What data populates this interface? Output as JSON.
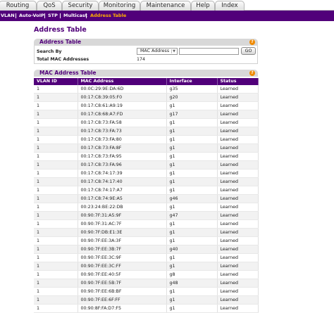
{
  "nav": {
    "tabs": [
      "Routing",
      "QoS",
      "Security",
      "Monitoring",
      "Maintenance",
      "Help",
      "Index"
    ]
  },
  "subnav": {
    "items": [
      "VLAN",
      "Auto-VoIP",
      "STP",
      "Multicast",
      "Address Table"
    ],
    "active": "Address Table"
  },
  "page": {
    "title": "Address Table"
  },
  "address_section": {
    "title": "Address Table",
    "search_by_label": "Search By",
    "search_by_value": "MAC Address",
    "search_input_value": "",
    "go_label": "GO",
    "total_label": "Total MAC Addresses",
    "total_value": "174"
  },
  "mac_section": {
    "title": "MAC Address Table"
  },
  "help_glyph": "?",
  "table": {
    "columns": [
      "VLAN ID",
      "MAC Address",
      "Interface",
      "Status"
    ],
    "rows": [
      [
        "1",
        "00:0C:29:9E:DA:6D",
        "g35",
        "Learned"
      ],
      [
        "1",
        "00:17:C8:39:05:F0",
        "g20",
        "Learned"
      ],
      [
        "1",
        "00:17:C8:61:A9:19",
        "g1",
        "Learned"
      ],
      [
        "1",
        "00:17:C8:68:A7:FD",
        "g17",
        "Learned"
      ],
      [
        "1",
        "00:17:C8:73:FA:58",
        "g1",
        "Learned"
      ],
      [
        "1",
        "00:17:C8:73:FA:73",
        "g1",
        "Learned"
      ],
      [
        "1",
        "00:17:C8:73:FA:80",
        "g1",
        "Learned"
      ],
      [
        "1",
        "00:17:C8:73:FA:8F",
        "g1",
        "Learned"
      ],
      [
        "1",
        "00:17:C8:73:FA:95",
        "g1",
        "Learned"
      ],
      [
        "1",
        "00:17:C8:73:FA:96",
        "g1",
        "Learned"
      ],
      [
        "1",
        "00:17:C8:74:17:39",
        "g1",
        "Learned"
      ],
      [
        "1",
        "00:17:C8:74:17:40",
        "g1",
        "Learned"
      ],
      [
        "1",
        "00:17:C8:74:17:A7",
        "g1",
        "Learned"
      ],
      [
        "1",
        "00:17:C8:74:9E:A5",
        "g46",
        "Learned"
      ],
      [
        "1",
        "00:23:24:BE:22:DB",
        "g1",
        "Learned"
      ],
      [
        "1",
        "00:90:7F:31:A5:9F",
        "g47",
        "Learned"
      ],
      [
        "1",
        "00:90:7F:31:AC:7F",
        "g1",
        "Learned"
      ],
      [
        "1",
        "00:90:7F:DB:E1:3E",
        "g1",
        "Learned"
      ],
      [
        "1",
        "00:90:7F:EE:3A:3F",
        "g1",
        "Learned"
      ],
      [
        "1",
        "00:90:7F:EE:3B:7F",
        "g40",
        "Learned"
      ],
      [
        "1",
        "00:90:7F:EE:3C:9F",
        "g1",
        "Learned"
      ],
      [
        "1",
        "00:90:7F:EE:3C:FF",
        "g1",
        "Learned"
      ],
      [
        "1",
        "00:90:7F:EE:40:5F",
        "g8",
        "Learned"
      ],
      [
        "1",
        "00:90:7F:EE:5B:7F",
        "g48",
        "Learned"
      ],
      [
        "1",
        "00:90:7F:EE:6B:BF",
        "g1",
        "Learned"
      ],
      [
        "1",
        "00:90:7F:EE:6F:FF",
        "g1",
        "Learned"
      ],
      [
        "1",
        "00:90:8F:FA:D7:F5",
        "g1",
        "Learned"
      ]
    ]
  }
}
